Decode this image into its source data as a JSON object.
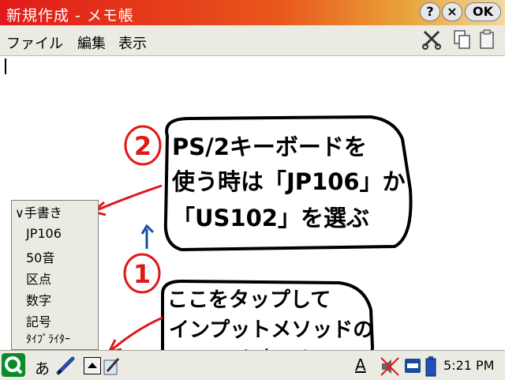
{
  "window": {
    "title": "新規作成 - メモ帳"
  },
  "titlebar_buttons": {
    "help": "?",
    "close": "×",
    "ok": "OK"
  },
  "menu": {
    "file": "ファイル",
    "edit": "編集",
    "view": "表示"
  },
  "toolbar_icons": [
    "cut-icon",
    "copy-icon",
    "paste-icon"
  ],
  "input_popup": {
    "header": "手書き",
    "options": [
      "JP106",
      "50音",
      "区点",
      "数字",
      "記号",
      "ﾀｲﾌﾟﾗｲﾀｰ"
    ]
  },
  "annotations": {
    "note_1": {
      "number": "1",
      "lines": [
        "ここをタップして",
        "インプットメソッドの",
        "リストを表示させる"
      ]
    },
    "note_2": {
      "number": "2",
      "lines": [
        "PS/2キーボードを",
        "使う時は「JP106」か",
        "「US102」を選ぶ"
      ]
    }
  },
  "taskbar": {
    "ime_label": "あ",
    "font_label": "A",
    "clock": "5:21 PM"
  },
  "colors": {
    "annotation_red": "#e01818",
    "annotation_blue": "#1050a0",
    "title_red": "#e21a1a"
  }
}
